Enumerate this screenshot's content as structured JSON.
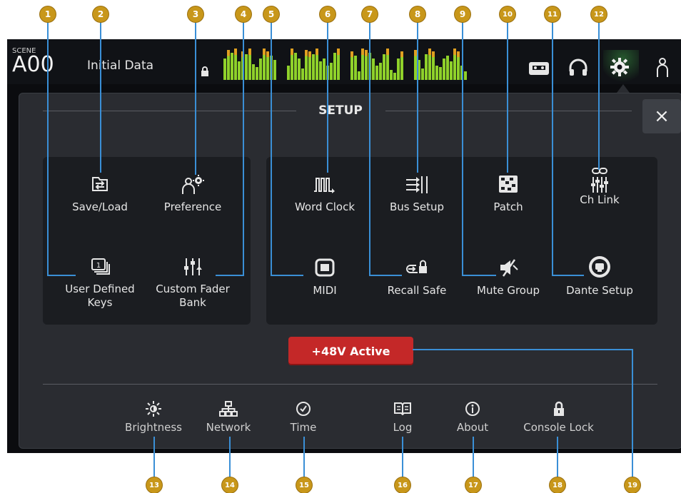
{
  "scene": {
    "small_label": "SCENE",
    "number": "A00",
    "title": "Initial Data"
  },
  "setup_title": "SETUP",
  "close_label": "×",
  "left_group": [
    {
      "label": "Save/Load",
      "icon": "save-load-icon"
    },
    {
      "label": "Preference",
      "icon": "preference-icon"
    },
    {
      "label": "User Defined\nKeys",
      "icon": "user-defined-keys-icon"
    },
    {
      "label": "Custom Fader\nBank",
      "icon": "custom-fader-bank-icon"
    }
  ],
  "right_group": [
    {
      "label": "Word Clock",
      "icon": "word-clock-icon"
    },
    {
      "label": "Bus Setup",
      "icon": "bus-setup-icon"
    },
    {
      "label": "Patch",
      "icon": "patch-icon"
    },
    {
      "label": "Ch Link",
      "icon": "ch-link-icon"
    },
    {
      "label": "MIDI",
      "icon": "midi-icon"
    },
    {
      "label": "Recall Safe",
      "icon": "recall-safe-icon"
    },
    {
      "label": "Mute Group",
      "icon": "mute-group-icon"
    },
    {
      "label": "Dante Setup",
      "icon": "dante-setup-icon"
    }
  ],
  "phantom_button": "+48V Active",
  "bottom_bar": [
    {
      "label": "Brightness",
      "icon": "brightness-icon"
    },
    {
      "label": "Network",
      "icon": "network-icon"
    },
    {
      "label": "Time",
      "icon": "time-icon"
    },
    {
      "label": "Log",
      "icon": "log-icon"
    },
    {
      "label": "About",
      "icon": "about-icon"
    },
    {
      "label": "Console Lock",
      "icon": "lock-icon"
    }
  ],
  "callouts": [
    "1",
    "2",
    "3",
    "4",
    "5",
    "6",
    "7",
    "8",
    "9",
    "10",
    "11",
    "12",
    "13",
    "14",
    "15",
    "16",
    "17",
    "18",
    "19"
  ],
  "colors": {
    "accent_marker": "#c8971a",
    "callout_line": "#3a8fd6",
    "phantom_red": "#c42828",
    "meter_green": "#8fd12a",
    "meter_amber": "#e0a020"
  }
}
